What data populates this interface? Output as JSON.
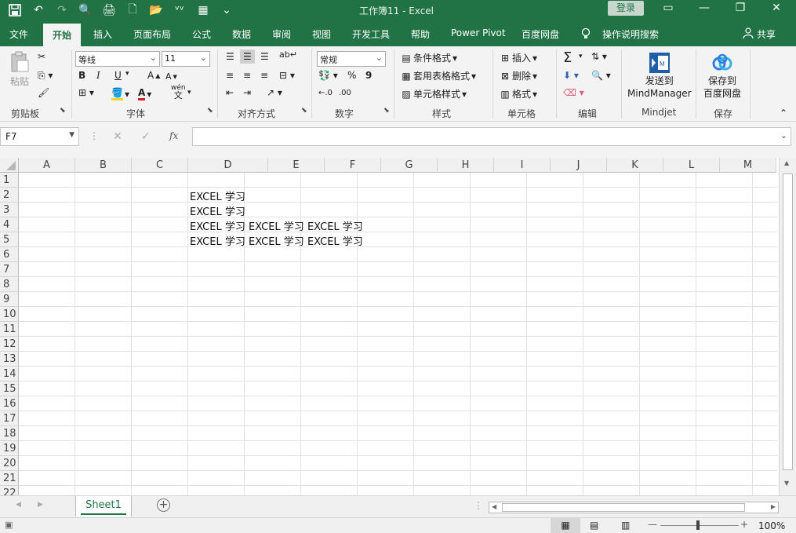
{
  "window": {
    "title": "工作簿11  -  Excel",
    "login_label": "登录",
    "minimize": "—",
    "restore": "❐",
    "close": "✕",
    "ribbon_display": "▭"
  },
  "qat": {
    "save": "💾",
    "undo": "↶",
    "redo": "↷",
    "preview": "🔍",
    "print": "🖨",
    "new": "🗋",
    "open": "📂",
    "custom": "ᵛᵛ",
    "table": "▦",
    "more": "⌄"
  },
  "tabs": [
    "文件",
    "开始",
    "插入",
    "页面布局",
    "公式",
    "数据",
    "审阅",
    "视图",
    "开发工具",
    "帮助",
    "Power Pivot",
    "百度网盘"
  ],
  "tell_me": "操作说明搜索",
  "share": "共享",
  "ribbon": {
    "clipboard": {
      "paste": "粘贴",
      "label": "剪贴板"
    },
    "font": {
      "name": "等线",
      "size": "11",
      "bold": "B",
      "italic": "I",
      "underline": "U",
      "grow": "A",
      "shrink": "A",
      "wen": "wén",
      "wen2": "文",
      "label": "字体"
    },
    "alignment": {
      "label": "对齐方式"
    },
    "number": {
      "format": "常规",
      "percent": "%",
      "comma": "9",
      "inc": "←.0",
      "dec": ".00",
      "label": "数字"
    },
    "styles": {
      "conditional": "条件格式",
      "table": "套用表格格式",
      "cell": "单元格样式",
      "label": "样式"
    },
    "cells": {
      "insert": "插入",
      "delete": "删除",
      "format": "格式",
      "label": "单元格"
    },
    "editing": {
      "sum": "Σ",
      "label": "编辑"
    },
    "mindjet": {
      "send1": "发送到",
      "send2": "MindManager",
      "label": "Mindjet"
    },
    "save": {
      "save1": "保存到",
      "save2": "百度网盘",
      "label": "保存"
    }
  },
  "formula_bar": {
    "name_box": "F7",
    "cancel": "✕",
    "enter": "✓",
    "fx": "fx",
    "value": ""
  },
  "columns": [
    "A",
    "B",
    "C",
    "D",
    "E",
    "F",
    "G",
    "H",
    "I",
    "J",
    "K",
    "L",
    "M"
  ],
  "rows": [
    "1",
    "2",
    "3",
    "4",
    "5",
    "6",
    "7",
    "8",
    "9",
    "10",
    "11",
    "12",
    "13",
    "14",
    "15",
    "16",
    "17",
    "18",
    "19",
    "20",
    "21",
    "22"
  ],
  "cells": {
    "D2": "EXCEL 学习",
    "D3": "EXCEL 学习",
    "D4": "EXCEL 学习 EXCEL 学习 EXCEL 学习",
    "D5": "EXCEL 学习 EXCEL 学习 EXCEL 学习"
  },
  "sheet_tabs": [
    "Sheet1"
  ],
  "status": {
    "zoom": "100%",
    "minus": "—",
    "plus": "+"
  },
  "colors": {
    "accent": "#217346",
    "ribbon": "#f3f3f3"
  }
}
